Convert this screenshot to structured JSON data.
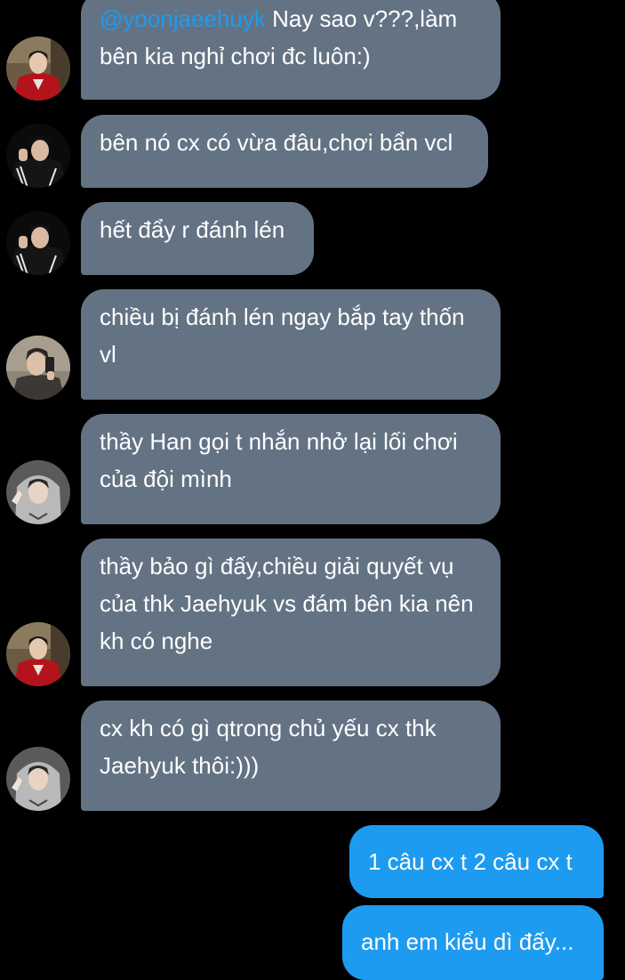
{
  "conversation": {
    "messages": [
      {
        "mention": "@yoonjaeehuyk",
        "text": " Nay sao v???,làm bên kia nghỉ chơi đc luôn:)"
      },
      {
        "text": "bên nó cx có vừa đâu,chơi bẩn vcl"
      },
      {
        "text": "hết đẩy r đánh lén"
      },
      {
        "text": "chiều bị đánh lén ngay bắp tay thốn vl"
      },
      {
        "text": "thầy Han gọi t nhắn nhở lại lối chơi của đội mình"
      },
      {
        "text": "thầy bảo gì đấy,chiều giải quyết vụ của thk Jaehyuk vs đám bên kia nên kh có nghe"
      },
      {
        "text": "cx kh có gì qtrong chủ yếu cx thk Jaehyuk thôi:)))"
      },
      {
        "text": "1 câu cx t 2 câu cx t"
      },
      {
        "text": "anh em kiểu dì đấy..."
      }
    ]
  },
  "colors": {
    "background": "#000000",
    "incoming_bubble": "#637384",
    "outgoing_bubble": "#1d9bf0",
    "mention": "#1d9bf0",
    "text": "#ffffff"
  },
  "icons": {
    "avatar_red_jacket": "avatar-red-jacket-icon",
    "avatar_black_hoodie": "avatar-black-hoodie-icon",
    "avatar_mirror_selfie": "avatar-mirror-selfie-icon",
    "avatar_grey_hood": "avatar-grey-hood-icon"
  }
}
